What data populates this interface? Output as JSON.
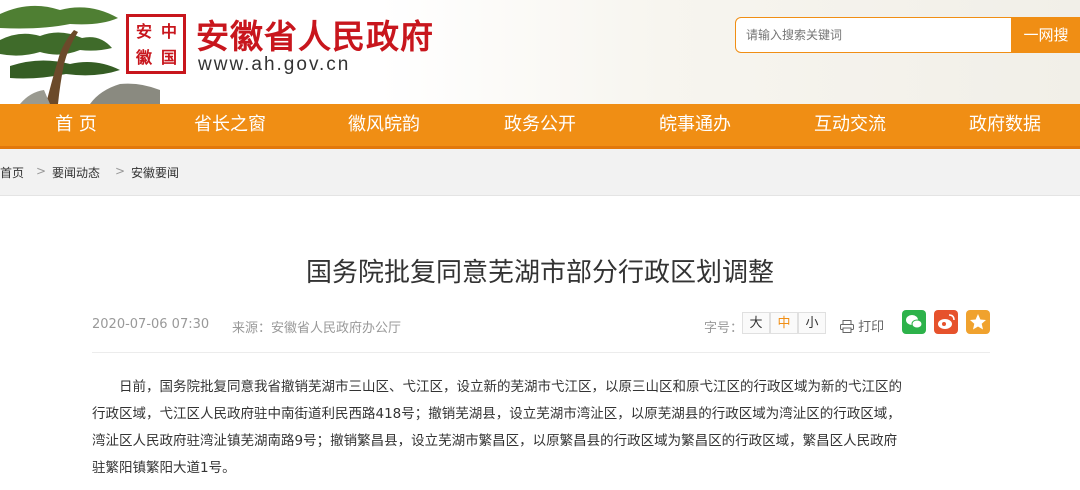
{
  "header": {
    "seal_chars": [
      "安",
      "中",
      "徽",
      "国"
    ],
    "brand_name": "安徽省人民政府",
    "url": "www.ah.gov.cn",
    "search": {
      "placeholder": "请输入搜索关键词",
      "button_label": "一网搜"
    }
  },
  "nav": {
    "items": [
      {
        "label": "首 页"
      },
      {
        "label": "省长之窗"
      },
      {
        "label": "徽风皖韵"
      },
      {
        "label": "政务公开"
      },
      {
        "label": "皖事通办"
      },
      {
        "label": "互动交流"
      },
      {
        "label": "政府数据"
      }
    ]
  },
  "breadcrumb": {
    "items": [
      "首页",
      "要闻动态",
      "安徽要闻"
    ],
    "separator": ">"
  },
  "article": {
    "title": "国务院批复同意芜湖市部分行政区划调整",
    "date": "2020-07-06 07:30",
    "source": "来源：安徽省人民政府办公厅",
    "font_size_label": "字号：",
    "font_sizes": [
      "大",
      "中",
      "小"
    ],
    "print_label": "打印",
    "share_icons": [
      "wechat-icon",
      "weibo-icon",
      "favorite-icon"
    ],
    "share_colors": {
      "wechat": "#2db24a",
      "weibo": "#e6522c",
      "favorite": "#f0a22e"
    },
    "body_lines": [
      "日前，国务院批复同意我省撤销芜湖市三山区、弋江区，设立新的芜湖市弋江区，以原三山区和原弋江区的行政区域为新的弋江区的",
      "行政区域，弋江区人民政府驻中南街道利民西路418号；撤销芜湖县，设立芜湖市湾沚区，以原芜湖县的行政区域为湾沚区的行政区域，",
      "湾沚区人民政府驻湾沚镇芜湖南路9号；撤销繁昌县，设立芜湖市繁昌区，以原繁昌县的行政区域为繁昌区的行政区域，繁昌区人民政府",
      "驻繁阳镇繁阳大道1号。"
    ]
  },
  "colors": {
    "brand_red": "#c8161d",
    "nav_orange": "#f08e14"
  }
}
